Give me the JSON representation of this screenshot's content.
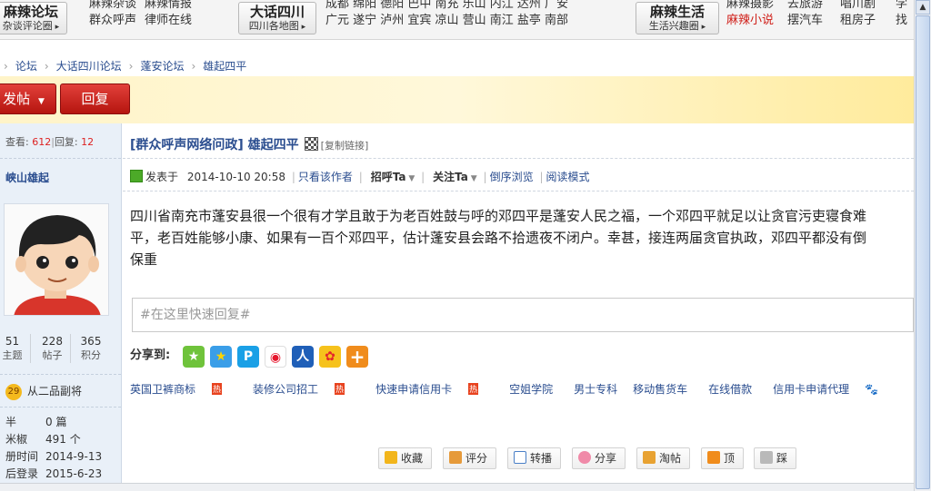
{
  "topbar": {
    "left_sub": "杂谈评论圈",
    "left_title": "麻辣论坛",
    "col1": [
      "麻辣杂谈",
      "群众呼声"
    ],
    "col2": [
      "麻辣情报",
      "律师在线"
    ],
    "mid_title": "大话四川",
    "mid_sub": "四川各地图",
    "cities_row1": "成都  绵阳  德阳  巴中  南充  乐山  内江  达州  广安",
    "cities_row2": "广元  遂宁  泸州  宜宾  凉山  营山  南江  盐亭  南部",
    "right_title": "麻辣生活",
    "right_sub": "生活兴趣圈",
    "r1": [
      "麻辣摄影",
      "麻辣小说"
    ],
    "r2": [
      "去旅游",
      "摆汽车"
    ],
    "r3": [
      "唱川剧",
      "租房子"
    ],
    "r4": [
      "学",
      "找"
    ]
  },
  "breadcrumb": {
    "items": [
      "论坛",
      "大话四川论坛",
      "蓬安论坛",
      "雄起四平"
    ]
  },
  "buttons": {
    "post": "发帖",
    "reply": "回复"
  },
  "left": {
    "view_label": "查看:",
    "views": "612",
    "reply_label": "回复:",
    "replies": "12",
    "username": "峡山雄起",
    "stats": [
      {
        "value": "51",
        "label": "主题"
      },
      {
        "value": "228",
        "label": "帖子"
      },
      {
        "value": "365",
        "label": "积分"
      }
    ],
    "level_num": "29",
    "level_name": "从二品副将",
    "info": [
      {
        "k": "半",
        "v": "0 篇"
      },
      {
        "k": "米椒",
        "v": "491 个"
      },
      {
        "k": "册时间",
        "v": "2014-9-13"
      },
      {
        "k": "后登录",
        "v": "2015-6-23"
      }
    ]
  },
  "post": {
    "title": "[群众呼声网络问政] 雄起四平",
    "copy_link": "[复制链接]",
    "posted_label": "发表于",
    "posted_time": "2014-10-10 20:58",
    "only_author": "只看该作者",
    "greet": "招呼Ta",
    "follow": "关注Ta",
    "reverse": "倒序浏览",
    "read_mode": "阅读模式",
    "body_line1": "四川省南充市蓬安县很一个很有才学且敢于为老百姓鼓与呼的邓四平是蓬安人民之福，一个邓四平就足以让贪官污吏寝食难",
    "body_line2": "平，老百姓能够小康、如果有一百个邓四平，估计蓬安县会路不拾遗夜不闭户。幸甚，接连两届贪官执政，邓四平都没有倒",
    "body_line3": "保重",
    "quick_reply_placeholder": "#在这里快速回复#",
    "share_label": "分享到:",
    "links": [
      "英国卫裤商标",
      "装修公司招工",
      "快速申请信用卡",
      "空姐学院",
      "男士专科",
      "移动售货车",
      "在线借款",
      "信用卡申请代理"
    ],
    "hot_tag": "热",
    "actions": [
      "收藏",
      "评分",
      "转播",
      "分享",
      "淘帖",
      "顶",
      "踩"
    ]
  },
  "colors": {
    "link": "#2a4d8f",
    "red_button": "#c8241c",
    "band_yellow": "#fff4c8",
    "left_panel": "#e9f0f8"
  }
}
